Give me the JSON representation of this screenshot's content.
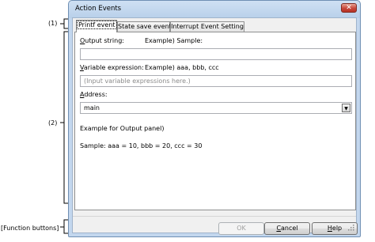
{
  "annotations": {
    "tab_marker": "(1)",
    "panel_marker": "(2)",
    "buttons_marker": "[Function buttons]"
  },
  "window": {
    "title": "Action Events",
    "close_glyph": "✕"
  },
  "tabs": [
    {
      "label": "Printf event",
      "active": true
    },
    {
      "label": "State save event",
      "active": false
    },
    {
      "label": "Interrupt Event Setting",
      "active": false
    }
  ],
  "panel": {
    "output_string_label_underlined": "O",
    "output_string_label_rest": "utput string:",
    "output_string_example": "Example) Sample:",
    "output_string_value": "",
    "variable_label_underlined": "V",
    "variable_label_rest": "ariable expression:",
    "variable_example": "Example) aaa, bbb, ccc",
    "variable_placeholder": "(Input variable expressions here.)",
    "address_label_underlined": "A",
    "address_label_rest": "ddress:",
    "address_value": "main",
    "dropdown_glyph": "▼",
    "example_heading": "Example for Output panel)",
    "example_text": "Sample: aaa = 10, bbb = 20, ccc = 30"
  },
  "buttons": {
    "ok": "OK",
    "cancel_underlined": "C",
    "cancel_rest": "ancel",
    "help_underlined": "H",
    "help_rest": "elp"
  },
  "colors": {
    "title_bar": "#b8d0ea",
    "close_button": "#c7463a",
    "panel_background": "#ffffff"
  }
}
